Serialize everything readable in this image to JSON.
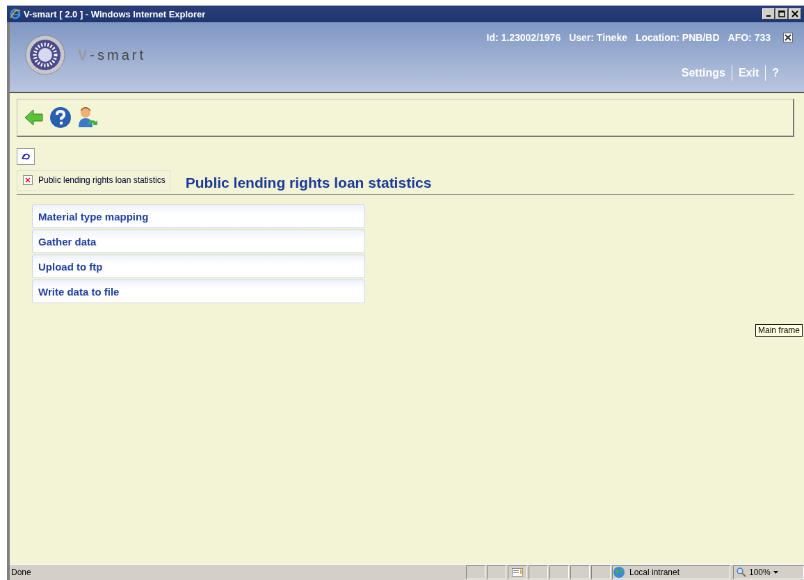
{
  "window": {
    "title": "V-smart [ 2.0 ] - Windows Internet Explorer"
  },
  "header": {
    "logo_text": "V-smart",
    "info": [
      "Id: 1.23002/1976",
      "User: Tineke",
      "Location: PNB/BD",
      "AFO: 733"
    ],
    "links": [
      "Settings",
      "Exit",
      "?"
    ]
  },
  "breadcrumb": {
    "label": "Public lending rights loan statistics"
  },
  "page_title": "Public lending rights loan statistics",
  "menu": [
    "Material type mapping",
    "Gather data",
    "Upload to ftp",
    "Write data to file"
  ],
  "tooltip": "Main frame",
  "status_bar": {
    "text": "Done",
    "zone": "Local intranet",
    "zoom": "100%"
  }
}
